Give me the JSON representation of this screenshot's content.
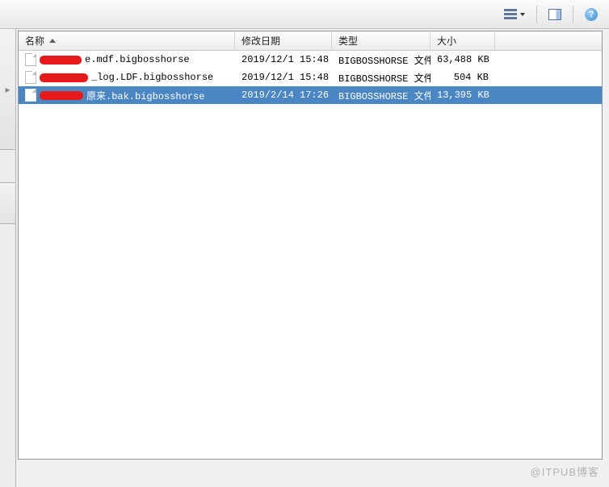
{
  "toolbar": {
    "view_menu": "视图",
    "help_symbol": "?"
  },
  "columns": {
    "name": "名称",
    "date": "修改日期",
    "type": "类型",
    "size": "大小"
  },
  "files": [
    {
      "redact_width": 52,
      "suffix": "e.mdf.bigbosshorse",
      "date": "2019/12/1 15:48",
      "type": "BIGBOSSHORSE 文件",
      "size": "63,488 KB",
      "selected": false
    },
    {
      "redact_width": 60,
      "suffix": "_log.LDF.bigbosshorse",
      "date": "2019/12/1 15:48",
      "type": "BIGBOSSHORSE 文件",
      "size": "504 KB",
      "selected": false
    },
    {
      "redact_width": 54,
      "suffix": "原来.bak.bigbosshorse",
      "date": "2019/2/14 17:26",
      "type": "BIGBOSSHORSE 文件",
      "size": "13,395 KB",
      "selected": true
    }
  ],
  "watermark": "@ITPUB博客"
}
